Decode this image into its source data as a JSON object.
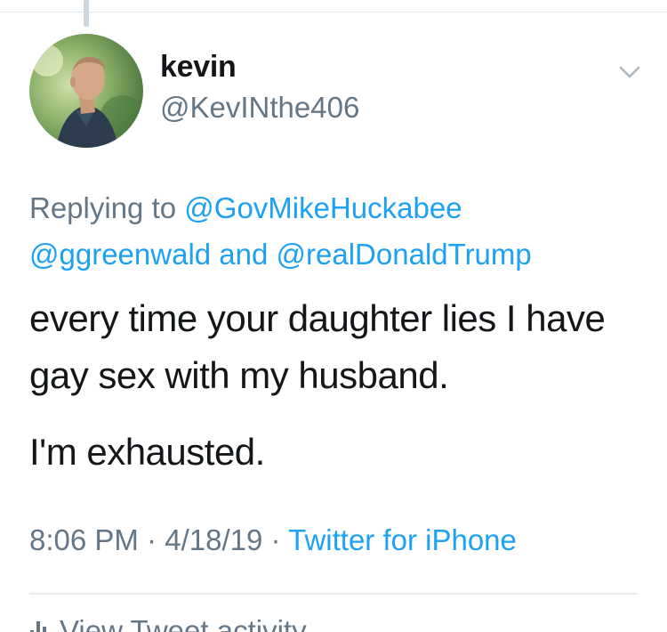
{
  "tweet": {
    "author": {
      "display_name": "kevin",
      "handle": "@KevINthe406"
    },
    "replying": {
      "prefix": "Replying to",
      "mention_1": "@GovMikeHuckabee",
      "mention_2": "@ggreenwald",
      "joiner": "and",
      "mention_3": "@realDonaldTrump"
    },
    "text_paragraph_1": "every time your daughter lies I have gay sex with my husband.",
    "text_paragraph_2": "I'm exhausted.",
    "time": "8:06 PM",
    "separator": "·",
    "date": "4/18/19",
    "source": "Twitter for iPhone"
  },
  "footer": {
    "activity_label": "View Tweet activity"
  },
  "colors": {
    "link_blue": "#1da1f2",
    "secondary_gray": "#657786",
    "primary_text": "#14171a",
    "divider": "#e1e8ed"
  },
  "icons": {
    "caret": "chevron-down-icon",
    "activity": "bar-chart-icon"
  }
}
